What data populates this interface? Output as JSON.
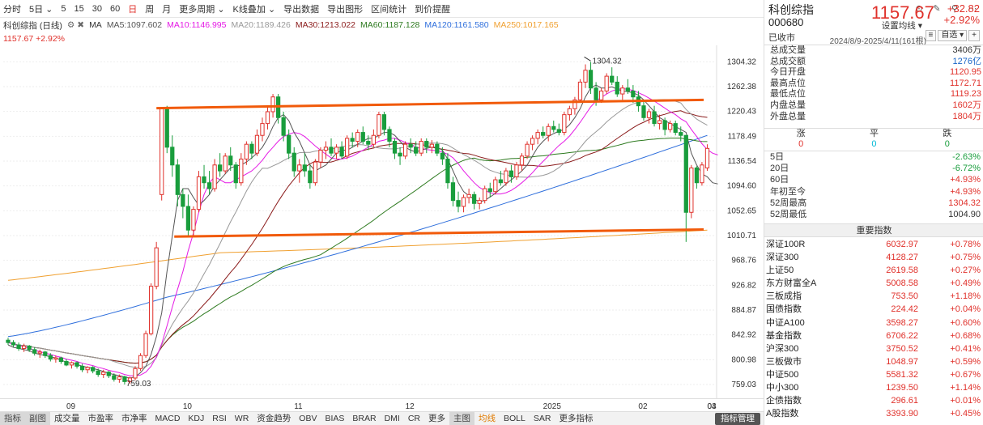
{
  "toolbar": {
    "items": [
      "分时",
      "5日",
      "5",
      "15",
      "30",
      "60",
      "日",
      "周",
      "月",
      "更多周期",
      "K线叠加",
      "导出数据",
      "导出图形",
      "区间统计",
      "到价提醒"
    ],
    "active": "日"
  },
  "chart_header": {
    "name": "科创综指 (日线)",
    "ma_label": "MA",
    "ma5": "MA5:1097.602",
    "ma10": "MA10:1146.995",
    "ma20": "MA20:1189.426",
    "ma30": "MA30:1213.022",
    "ma60": "MA60:1187.128",
    "ma120": "MA120:1161.580",
    "ma250": "MA250:1017.165",
    "price_line": "1157.67 +2.92%",
    "range": "2024/8/9-2025/4/11(161根)",
    "setting": "设置均线"
  },
  "colors": {
    "up": "#e0312b",
    "down": "#199d3c",
    "ma5": "#555555",
    "ma10": "#e51ae5",
    "ma20": "#999999",
    "ma30": "#8a1a1a",
    "ma60": "#2d7a1f",
    "ma120": "#2f6fdc",
    "ma250": "#f0a030",
    "trend": "#f15a0a"
  },
  "chart_data": {
    "type": "candlestick",
    "x_ticks": [
      "09",
      "10",
      "11",
      "12",
      "2025",
      "02",
      "03",
      "04"
    ],
    "y_ticks": [
      759.03,
      800.98,
      842.92,
      884.87,
      926.82,
      968.76,
      1010.71,
      1052.65,
      1094.6,
      1136.54,
      1178.49,
      1220.43,
      1262.38,
      1304.32
    ],
    "ylim": [
      759.03,
      1325.3
    ],
    "annotations": [
      {
        "label": "1304.32",
        "value": 1304.32
      },
      {
        "label": "759.03",
        "value": 759.03
      }
    ],
    "ohlc": [
      [
        834,
        838,
        826,
        830
      ],
      [
        830,
        834,
        822,
        826
      ],
      [
        826,
        830,
        816,
        820
      ],
      [
        820,
        828,
        814,
        824
      ],
      [
        824,
        826,
        814,
        818
      ],
      [
        818,
        822,
        808,
        812
      ],
      [
        812,
        818,
        804,
        814
      ],
      [
        814,
        816,
        804,
        808
      ],
      [
        808,
        812,
        798,
        802
      ],
      [
        802,
        808,
        796,
        804
      ],
      [
        804,
        806,
        794,
        798
      ],
      [
        798,
        802,
        790,
        792
      ],
      [
        792,
        798,
        786,
        796
      ],
      [
        796,
        798,
        786,
        790
      ],
      [
        790,
        794,
        780,
        784
      ],
      [
        784,
        790,
        778,
        788
      ],
      [
        788,
        790,
        778,
        782
      ],
      [
        782,
        786,
        772,
        776
      ],
      [
        776,
        784,
        770,
        780
      ],
      [
        780,
        782,
        770,
        774
      ],
      [
        774,
        778,
        764,
        768
      ],
      [
        768,
        776,
        762,
        772
      ],
      [
        772,
        774,
        759,
        764
      ],
      [
        764,
        772,
        760,
        770
      ],
      [
        770,
        790,
        766,
        786
      ],
      [
        786,
        812,
        782,
        808
      ],
      [
        808,
        850,
        804,
        845
      ],
      [
        845,
        930,
        842,
        925
      ],
      [
        925,
        1000,
        920,
        990
      ],
      [
        1080,
        1228,
        1070,
        1225
      ],
      [
        1225,
        1230,
        1150,
        1160
      ],
      [
        1160,
        1180,
        1110,
        1130
      ],
      [
        1130,
        1140,
        1060,
        1080
      ],
      [
        1080,
        1090,
        1040,
        1060
      ],
      [
        1060,
        1080,
        1010,
        1020
      ],
      [
        1020,
        1060,
        1010,
        1055
      ],
      [
        1055,
        1120,
        1050,
        1110
      ],
      [
        1110,
        1130,
        1090,
        1100
      ],
      [
        1100,
        1120,
        1080,
        1090
      ],
      [
        1090,
        1140,
        1085,
        1130
      ],
      [
        1130,
        1150,
        1110,
        1120
      ],
      [
        1120,
        1150,
        1115,
        1145
      ],
      [
        1145,
        1160,
        1120,
        1130
      ],
      [
        1130,
        1135,
        1090,
        1100
      ],
      [
        1100,
        1150,
        1095,
        1140
      ],
      [
        1140,
        1170,
        1130,
        1165
      ],
      [
        1165,
        1170,
        1140,
        1150
      ],
      [
        1150,
        1190,
        1145,
        1180
      ],
      [
        1180,
        1210,
        1170,
        1200
      ],
      [
        1200,
        1230,
        1190,
        1220
      ],
      [
        1220,
        1250,
        1210,
        1245
      ],
      [
        1245,
        1250,
        1200,
        1210
      ],
      [
        1210,
        1220,
        1170,
        1180
      ],
      [
        1180,
        1190,
        1140,
        1150
      ],
      [
        1150,
        1160,
        1110,
        1120
      ],
      [
        1120,
        1140,
        1100,
        1130
      ],
      [
        1130,
        1150,
        1110,
        1120
      ],
      [
        1120,
        1130,
        1090,
        1100
      ],
      [
        1100,
        1140,
        1095,
        1135
      ],
      [
        1135,
        1160,
        1125,
        1155
      ],
      [
        1155,
        1170,
        1140,
        1160
      ],
      [
        1160,
        1175,
        1145,
        1150
      ],
      [
        1150,
        1165,
        1140,
        1160
      ],
      [
        1160,
        1170,
        1140,
        1145
      ],
      [
        1145,
        1180,
        1140,
        1175
      ],
      [
        1175,
        1185,
        1160,
        1170
      ],
      [
        1170,
        1190,
        1160,
        1185
      ],
      [
        1185,
        1195,
        1165,
        1170
      ],
      [
        1170,
        1180,
        1155,
        1165
      ],
      [
        1165,
        1190,
        1160,
        1180
      ],
      [
        1180,
        1220,
        1175,
        1215
      ],
      [
        1215,
        1220,
        1180,
        1190
      ],
      [
        1190,
        1195,
        1160,
        1170
      ],
      [
        1170,
        1175,
        1140,
        1150
      ],
      [
        1150,
        1160,
        1130,
        1145
      ],
      [
        1145,
        1170,
        1140,
        1165
      ],
      [
        1165,
        1175,
        1150,
        1160
      ],
      [
        1160,
        1170,
        1145,
        1150
      ],
      [
        1150,
        1175,
        1145,
        1170
      ],
      [
        1170,
        1175,
        1150,
        1160
      ],
      [
        1160,
        1172,
        1150,
        1165
      ],
      [
        1165,
        1170,
        1145,
        1150
      ],
      [
        1150,
        1160,
        1130,
        1140
      ],
      [
        1140,
        1150,
        1090,
        1100
      ],
      [
        1100,
        1110,
        1060,
        1070
      ],
      [
        1070,
        1085,
        1050,
        1060
      ],
      [
        1060,
        1080,
        1050,
        1075
      ],
      [
        1075,
        1090,
        1065,
        1080
      ],
      [
        1080,
        1085,
        1055,
        1065
      ],
      [
        1065,
        1075,
        1055,
        1070
      ],
      [
        1070,
        1095,
        1065,
        1090
      ],
      [
        1090,
        1100,
        1075,
        1085
      ],
      [
        1085,
        1110,
        1080,
        1105
      ],
      [
        1105,
        1120,
        1095,
        1100
      ],
      [
        1100,
        1125,
        1095,
        1120
      ],
      [
        1120,
        1130,
        1100,
        1110
      ],
      [
        1110,
        1135,
        1105,
        1130
      ],
      [
        1130,
        1150,
        1120,
        1145
      ],
      [
        1145,
        1170,
        1140,
        1165
      ],
      [
        1165,
        1180,
        1155,
        1175
      ],
      [
        1175,
        1190,
        1165,
        1185
      ],
      [
        1185,
        1195,
        1175,
        1180
      ],
      [
        1180,
        1200,
        1170,
        1195
      ],
      [
        1195,
        1205,
        1185,
        1190
      ],
      [
        1190,
        1200,
        1180,
        1185
      ],
      [
        1185,
        1220,
        1180,
        1215
      ],
      [
        1215,
        1230,
        1205,
        1225
      ],
      [
        1225,
        1245,
        1215,
        1240
      ],
      [
        1240,
        1275,
        1235,
        1270
      ],
      [
        1270,
        1300,
        1260,
        1290
      ],
      [
        1290,
        1304,
        1250,
        1260
      ],
      [
        1260,
        1270,
        1230,
        1240
      ],
      [
        1240,
        1260,
        1235,
        1255
      ],
      [
        1255,
        1285,
        1250,
        1280
      ],
      [
        1280,
        1295,
        1265,
        1270
      ],
      [
        1270,
        1280,
        1245,
        1250
      ],
      [
        1250,
        1265,
        1240,
        1260
      ],
      [
        1260,
        1275,
        1250,
        1255
      ],
      [
        1255,
        1265,
        1235,
        1245
      ],
      [
        1245,
        1255,
        1220,
        1230
      ],
      [
        1230,
        1240,
        1205,
        1210
      ],
      [
        1210,
        1225,
        1200,
        1220
      ],
      [
        1220,
        1230,
        1195,
        1200
      ],
      [
        1200,
        1215,
        1190,
        1205
      ],
      [
        1205,
        1210,
        1180,
        1190
      ],
      [
        1190,
        1205,
        1185,
        1200
      ],
      [
        1200,
        1205,
        1180,
        1185
      ],
      [
        1185,
        1195,
        1170,
        1180
      ],
      [
        1180,
        1140,
        1000,
        1050
      ],
      [
        1050,
        1130,
        1040,
        1125
      ],
      [
        1125,
        1128,
        1090,
        1100
      ],
      [
        1100,
        1135,
        1095,
        1130
      ],
      [
        1125,
        1165,
        1120,
        1158
      ]
    ],
    "ma": {
      "ma5": [
        826,
        822,
        820,
        818,
        816,
        812,
        810,
        808,
        806,
        804,
        800,
        797,
        795,
        793,
        790,
        788,
        786,
        784,
        781,
        778,
        776,
        774,
        772,
        770,
        772,
        779,
        790,
        810,
        840,
        880,
        950,
        1010,
        1070,
        1090,
        1090,
        1075,
        1062,
        1070,
        1080,
        1095,
        1105,
        1115,
        1125,
        1128,
        1130,
        1135,
        1142,
        1150,
        1160,
        1175,
        1195,
        1210,
        1215,
        1205,
        1185,
        1170,
        1150,
        1130,
        1120,
        1125,
        1130,
        1140,
        1150,
        1155,
        1155,
        1160,
        1165,
        1170,
        1175,
        1175,
        1180,
        1185,
        1185,
        1180,
        1170,
        1160,
        1155,
        1152,
        1155,
        1158,
        1160,
        1160,
        1155,
        1140,
        1120,
        1100,
        1085,
        1078,
        1072,
        1068,
        1070,
        1076,
        1082,
        1090,
        1098,
        1105,
        1112,
        1120,
        1130,
        1145,
        1160,
        1170,
        1178,
        1183,
        1187,
        1190,
        1198,
        1210,
        1225,
        1245,
        1260,
        1265,
        1260,
        1260,
        1262,
        1258,
        1255,
        1254,
        1252,
        1248,
        1240,
        1230,
        1220,
        1210,
        1205,
        1200,
        1195,
        1190,
        1185,
        1150,
        1130,
        1115,
        1110,
        1100,
        1098
      ],
      "ma10": [
        830,
        827,
        825,
        823,
        820,
        817,
        815,
        812,
        810,
        807,
        805,
        802,
        800,
        798,
        795,
        793,
        791,
        788,
        786,
        783,
        781,
        779,
        776,
        774,
        774,
        775,
        780,
        790,
        806,
        828,
        858,
        890,
        920,
        950,
        985,
        1015,
        1050,
        1080,
        1100,
        1110,
        1105,
        1100,
        1100,
        1105,
        1110,
        1115,
        1120,
        1128,
        1138,
        1150,
        1160,
        1170,
        1178,
        1182,
        1185,
        1183,
        1178,
        1170,
        1162,
        1155,
        1148,
        1142,
        1140,
        1140,
        1142,
        1145,
        1150,
        1155,
        1160,
        1165,
        1170,
        1172,
        1175,
        1175,
        1172,
        1168,
        1164,
        1160,
        1158,
        1156,
        1155,
        1154,
        1152,
        1148,
        1142,
        1132,
        1120,
        1110,
        1100,
        1092,
        1087,
        1083,
        1081,
        1081,
        1083,
        1087,
        1093,
        1100,
        1108,
        1117,
        1127,
        1136,
        1145,
        1154,
        1163,
        1170,
        1179,
        1190,
        1202,
        1215,
        1228,
        1238,
        1244,
        1250,
        1255,
        1258,
        1259,
        1258,
        1256,
        1252,
        1248,
        1243,
        1238,
        1232,
        1226,
        1220,
        1215,
        1208,
        1203,
        1190,
        1178,
        1166,
        1156,
        1150,
        1147
      ]
    },
    "trendlines": [
      {
        "from": [
          0.215,
          1226
        ],
        "to": [
          0.983,
          1240
        ]
      },
      {
        "from": [
          0.24,
          1009
        ],
        "to": [
          0.983,
          1021
        ]
      }
    ]
  },
  "panel": {
    "name": "科创综指",
    "code": "000680",
    "price": "1157.67",
    "change": "+32.82",
    "change_pct": "+2.92%",
    "status": "已收市",
    "btn_watch": "自选",
    "btn_plus": "+",
    "btn_menu": "≡",
    "stats": [
      {
        "k": "总成交量",
        "v": "3406万",
        "c": ""
      },
      {
        "k": "总成交额",
        "v": "1276亿",
        "c": "b"
      },
      {
        "k": "今日开盘",
        "v": "1120.95",
        "c": "r"
      },
      {
        "k": "最高点位",
        "v": "1172.71",
        "c": "r"
      },
      {
        "k": "最低点位",
        "v": "1119.23",
        "c": "r"
      },
      {
        "k": "内盘总量",
        "v": "1602万",
        "c": "r"
      },
      {
        "k": "外盘总量",
        "v": "1804万",
        "c": "r"
      }
    ],
    "breadth": {
      "h1": "涨",
      "h2": "平",
      "h3": "跌",
      "v1": "0",
      "v2": "0",
      "v3": "0"
    },
    "periods": [
      {
        "k": "5日",
        "v": "-2.63%",
        "c": "green"
      },
      {
        "k": "20日",
        "v": "-6.72%",
        "c": "green"
      },
      {
        "k": "60日",
        "v": "+4.93%",
        "c": "red"
      },
      {
        "k": "年初至今",
        "v": "+4.93%",
        "c": "red"
      },
      {
        "k": "52周最高",
        "v": "1304.32",
        "c": "red"
      },
      {
        "k": "52周最低",
        "v": "1004.90",
        "c": ""
      }
    ],
    "idx_title": "重要指数",
    "indices": [
      {
        "n": "深证100R",
        "p": "6032.97",
        "c": "+0.78%"
      },
      {
        "n": "深证300",
        "p": "4128.27",
        "c": "+0.75%"
      },
      {
        "n": "上证50",
        "p": "2619.58",
        "c": "+0.27%"
      },
      {
        "n": "东方财富全A",
        "p": "5008.58",
        "c": "+0.49%"
      },
      {
        "n": "三板成指",
        "p": "753.50",
        "c": "+1.18%"
      },
      {
        "n": "国债指数",
        "p": "224.42",
        "c": "+0.04%"
      },
      {
        "n": "中证A100",
        "p": "3598.27",
        "c": "+0.60%"
      },
      {
        "n": "基金指数",
        "p": "6706.22",
        "c": "+0.68%"
      },
      {
        "n": "沪深300",
        "p": "3750.52",
        "c": "+0.41%"
      },
      {
        "n": "三板做市",
        "p": "1048.97",
        "c": "+0.59%"
      },
      {
        "n": "中证500",
        "p": "5581.32",
        "c": "+0.67%"
      },
      {
        "n": "中小300",
        "p": "1239.50",
        "c": "+1.14%"
      },
      {
        "n": "企债指数",
        "p": "296.61",
        "c": "+0.01%"
      },
      {
        "n": "A股指数",
        "p": "3393.90",
        "c": "+0.45%"
      }
    ]
  },
  "bottom_tabs": {
    "items": [
      "指标",
      "副图",
      "成交量",
      "市盈率",
      "市净率",
      "MACD",
      "KDJ",
      "RSI",
      "WR",
      "资金趋势",
      "OBV",
      "BIAS",
      "BRAR",
      "DMI",
      "CR",
      "更多",
      "主图",
      "均线",
      "BOLL",
      "SAR",
      "更多指标"
    ],
    "manage": "指标管理"
  }
}
